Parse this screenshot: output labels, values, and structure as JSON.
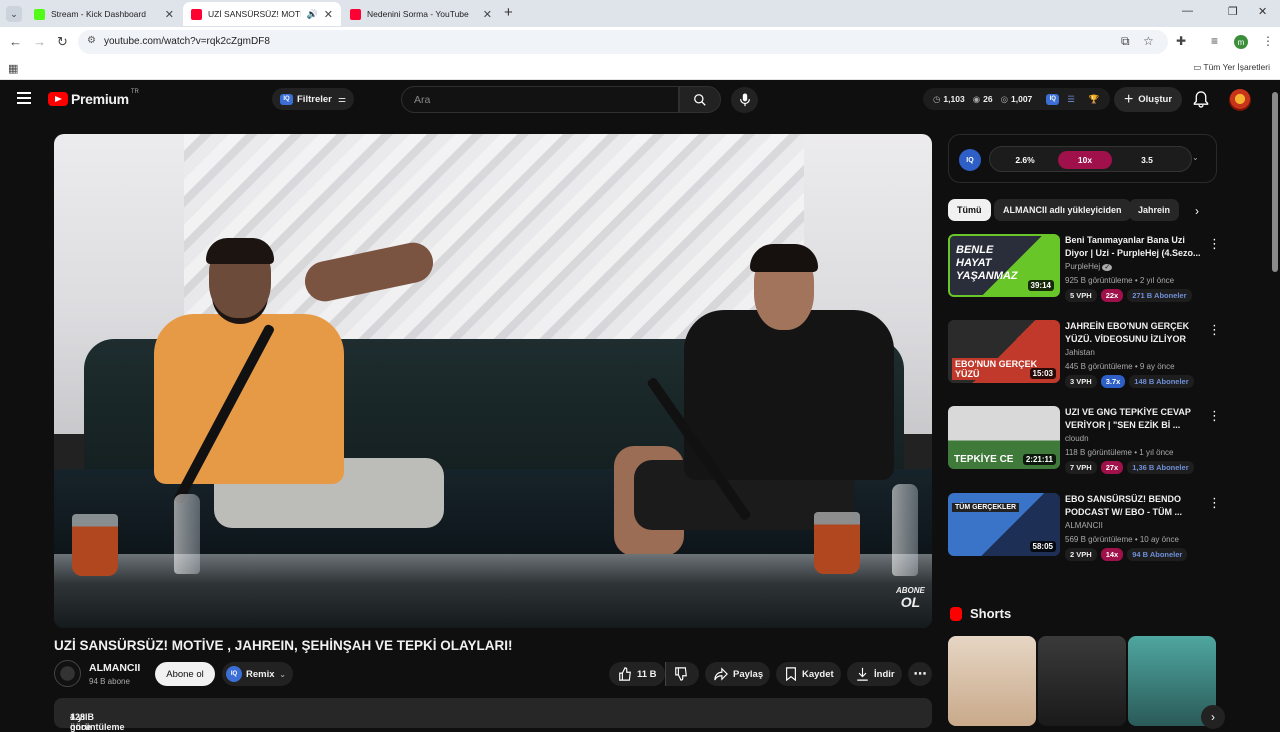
{
  "browser": {
    "tabs": [
      {
        "title": "Stream - Kick Dashboard",
        "color": "#53fc18"
      },
      {
        "title": "UZİ SANSÜRSÜZ! MOTİVE",
        "color": "#ff0033"
      },
      {
        "title": "Nedenini Sorma - YouTube",
        "color": "#ff0033"
      }
    ],
    "url": "youtube.com/watch?v=rqk2cZgmDF8",
    "bookmarks_all": "Tüm Yer İşaretleri",
    "profile_letter": "m"
  },
  "header": {
    "logo_text": "Premium",
    "logo_region": "TR",
    "filter_label": "Filtreler",
    "search_placeholder": "Ara",
    "stats": {
      "watch": "1,103",
      "views": "26",
      "eye": "1,007"
    },
    "create_label": "Oluştur"
  },
  "video": {
    "title": "UZİ SANSÜRSÜZ! MOTİVE , JAHREIN, ŞEHİNŞAH VE TEPKİ OLAYLARI!",
    "watermark_line1": "ABONE",
    "watermark_line2": "OL",
    "channel_name": "ALMANCII",
    "channel_subs": "94 B abone",
    "subscribe_label": "Abone ol",
    "remix_label": "Remix",
    "likes": "11 B",
    "share_label": "Paylaş",
    "save_label": "Kaydet",
    "download_label": "İndir",
    "views_line": "428 B görüntüleme",
    "date_line": "1 yıl önce"
  },
  "iq": {
    "icon_text": "IQ",
    "chips": [
      {
        "label": "2.6%",
        "color": "#1c1c1c"
      },
      {
        "label": "10x",
        "color": "#a0104a"
      },
      {
        "label": "3.5",
        "color": "#1c1c1c"
      }
    ]
  },
  "filter_tabs": [
    "Tümü",
    "ALMANCII adlı yükleyiciden",
    "Jahrein"
  ],
  "recommendations": [
    {
      "title": "Beni Tanımayanlar Bana Uzi Diyor | Uzi - PurpleHej (4.Sezo...",
      "channel": "PurpleHej",
      "verified": true,
      "views": "925 B görüntüleme",
      "age": "2 yıl önce",
      "duration": "39:14",
      "vph": "5 VPH",
      "mult": "22x",
      "mult_color": "#a0104a",
      "subs": "271 B Aboneler",
      "thumb_text": "BENLE HAYAT YAŞANMAZ",
      "thumb_colors": [
        "#2a2d3a",
        "#69c629"
      ]
    },
    {
      "title": "JAHREİN EBO'NUN GERÇEK YÜZÜ. VİDEOSUNU İZLİYOR",
      "channel": "Jahistan",
      "verified": false,
      "views": "445 B görüntüleme",
      "age": "9 ay önce",
      "duration": "15:03",
      "vph": "3 VPH",
      "mult": "3.7x",
      "mult_color": "#2d5fc7",
      "subs": "148 B Aboneler",
      "thumb_text": "EBO'NUN GERÇEK YÜZÜ",
      "thumb_colors": [
        "#2b2b2b",
        "#c0392b"
      ]
    },
    {
      "title": "UZI VE GNG TEPKİYE CEVAP VERİYOR | \"SEN EZİK Bİ ...",
      "channel": "cloudn",
      "verified": false,
      "views": "118 B görüntüleme",
      "age": "1 yıl önce",
      "duration": "2:21:11",
      "vph": "7 VPH",
      "mult": "27x",
      "mult_color": "#a0104a",
      "subs": "1,36 B Aboneler",
      "thumb_text": "TEPKİYE CE",
      "thumb_colors": [
        "#d9d9d9",
        "#3f7a3a"
      ]
    },
    {
      "title": "EBO SANSÜRSÜZ! BENDO PODCAST W/ EBO - TÜM ...",
      "channel": "ALMANCII",
      "verified": false,
      "views": "569 B görüntüleme",
      "age": "10 ay önce",
      "duration": "58:05",
      "vph": "2 VPH",
      "mult": "14x",
      "mult_color": "#a0104a",
      "subs": "94 B Aboneler",
      "thumb_text": "TÜM GERÇEKLER",
      "thumb_colors": [
        "#3a74c9",
        "#1d2f55"
      ]
    }
  ],
  "shorts": {
    "title": "Shorts",
    "colors": [
      "#d9c9b8",
      "#2b2b2b",
      "#3c8a8a"
    ]
  }
}
